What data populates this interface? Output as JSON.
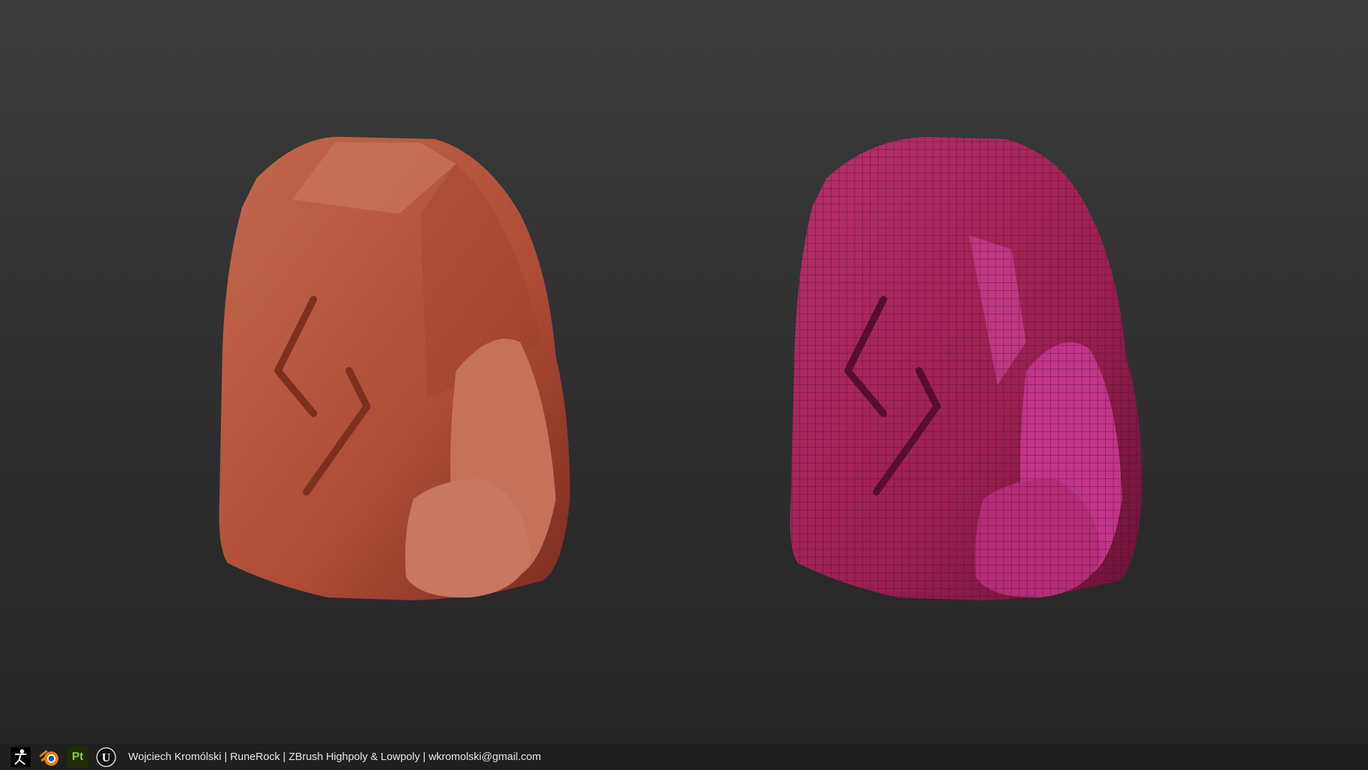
{
  "caption": "Wojciech Kromólski | RuneRock | ZBrush Highpoly & Lowpoly | wkromolski@gmail.com",
  "icons": [
    "zbrush-icon",
    "blender-icon",
    "substance-painter-icon",
    "unreal-engine-icon"
  ],
  "painter_label": "Pt",
  "colors": {
    "highpoly": "#b4523a",
    "lowpoly": "#a8235a",
    "wire": "#3a0f22",
    "background": "#2e2e2e"
  }
}
